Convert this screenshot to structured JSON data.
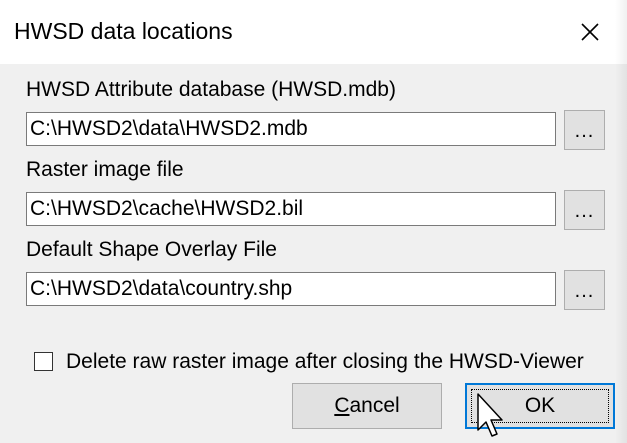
{
  "window": {
    "title": "HWSD data locations",
    "close_icon": "close-x"
  },
  "fields": [
    {
      "label": "HWSD Attribute database (HWSD.mdb)",
      "value": "C:\\HWSD2\\data\\HWSD2.mdb",
      "browse_label": "..."
    },
    {
      "label": "Raster image file",
      "value": "C:\\HWSD2\\cache\\HWSD2.bil",
      "browse_label": "..."
    },
    {
      "label": "Default Shape Overlay File",
      "value": "C:\\HWSD2\\data\\country.shp",
      "browse_label": "..."
    }
  ],
  "delete_raster": {
    "label": "Delete raw raster image after closing the HWSD-Viewer",
    "checked": false
  },
  "buttons": {
    "cancel_label": "Cancel",
    "cancel_accesskey": "C",
    "ok_label": "OK"
  },
  "colors": {
    "dialog_bg": "#f0f0f0",
    "button_bg": "#e1e1e1",
    "focus_border": "#0078d7"
  }
}
